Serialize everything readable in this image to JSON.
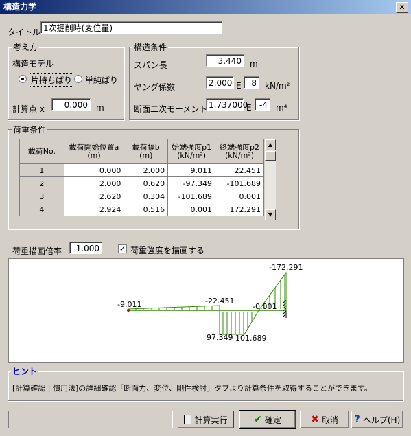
{
  "window": {
    "title": "構造力学",
    "close_label": "✕"
  },
  "title_field": {
    "label": "タイトル",
    "value": "1次掘削時(変位量)"
  },
  "approach": {
    "group_label": "考え方",
    "model_label": "構造モデル",
    "radio1_label": "片持ちばり",
    "radio2_label": "単純ばり",
    "calc_point_label": "計算点 x",
    "calc_point_value": "0.000",
    "calc_point_unit": "m"
  },
  "structure": {
    "group_label": "構造条件",
    "span_label": "スパン長",
    "span_value": "3.440",
    "span_unit": "m",
    "young_label": "ヤング係数",
    "young_value": "2.000",
    "young_e": "E",
    "young_exp": "8",
    "young_unit": "kN/m²",
    "inertia_label": "断面二次モーメント",
    "inertia_value": "1.737000",
    "inertia_e": "E",
    "inertia_exp": "-4",
    "inertia_unit": "m⁴"
  },
  "load": {
    "group_label": "荷重条件",
    "headers": [
      "載荷No.",
      "載荷開始位置a\n(m)",
      "載荷幅b\n(m)",
      "始端強度p1\n(kN/m²)",
      "終端強度p2\n(kN/m²)"
    ],
    "rows": [
      {
        "no": "1",
        "a": "0.000",
        "b": "2.000",
        "p1": "9.011",
        "p2": "22.451"
      },
      {
        "no": "2",
        "a": "2.000",
        "b": "0.620",
        "p1": "-97.349",
        "p2": "-101.689"
      },
      {
        "no": "3",
        "a": "2.620",
        "b": "0.304",
        "p1": "-101.689",
        "p2": "0.001"
      },
      {
        "no": "4",
        "a": "2.924",
        "b": "0.516",
        "p1": "0.001",
        "p2": "172.291"
      }
    ],
    "scroll_up": "▲",
    "scroll_down": "▼"
  },
  "draw": {
    "scale_label": "荷重描画倍率",
    "scale_value": "1.000",
    "check_label": "荷重強度を描画する",
    "check_mark": "✓",
    "labels": {
      "l1": "-9.011",
      "l2": "-22.451",
      "l3": "-0.001",
      "l4": "-172.291",
      "l5": "97.349",
      "l6": "101.689"
    }
  },
  "hint": {
    "label": "ヒント",
    "text": "[計算確認 | 慣用法]の詳細確認「断面力、変位、剛性検討」タブより計算条件を取得することができます。"
  },
  "buttons": {
    "calc": "計算実行",
    "ok": "確定",
    "cancel": "取消",
    "help": "ヘルプ(H)"
  },
  "colors": {
    "title_bar": "#0a246a",
    "load_arrow": "#2e8b00",
    "beam": "#2e8b00",
    "hint_label": "#0000cc"
  }
}
